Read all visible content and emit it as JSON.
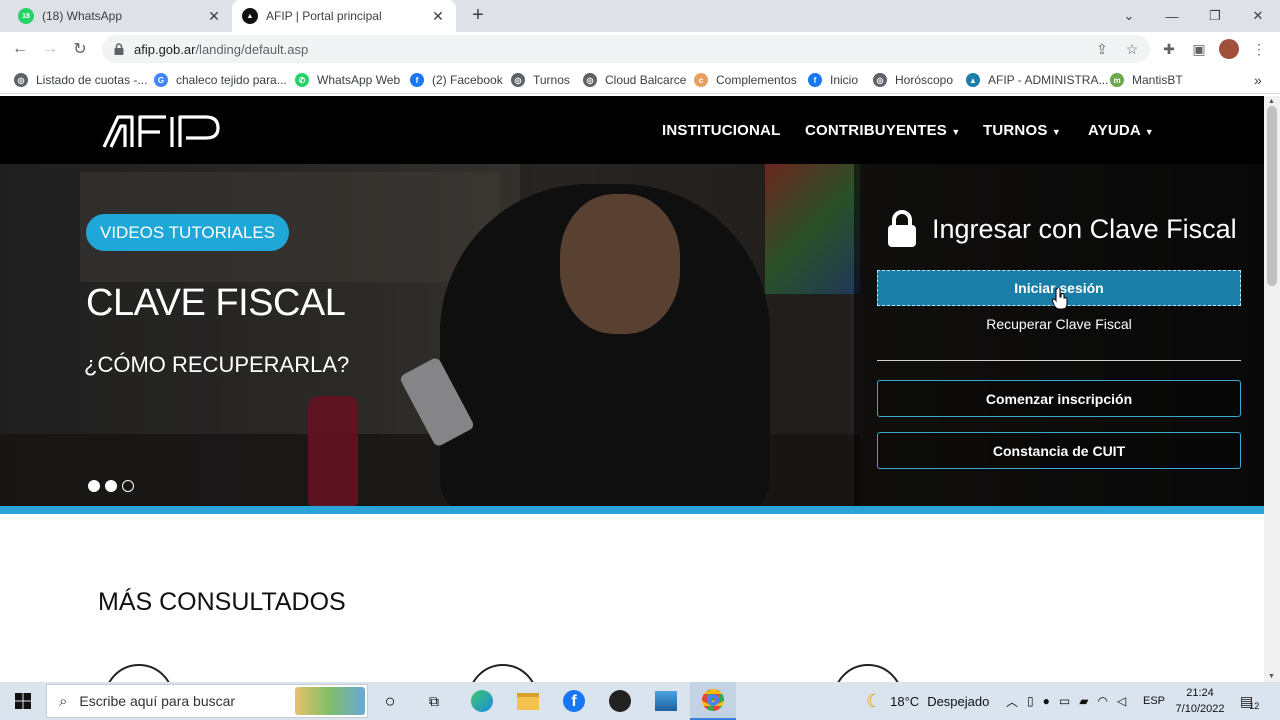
{
  "browser": {
    "tabs": [
      {
        "title": "(18) WhatsApp",
        "badge": "18",
        "active": false
      },
      {
        "title": "AFIP | Portal principal",
        "active": true
      }
    ],
    "url_host": "afip.gob.ar",
    "url_path": "/landing/default.asp",
    "bookmarks": [
      {
        "label": "Listado de cuotas -...",
        "icon": "globe-icon",
        "color": "#5f6368"
      },
      {
        "label": "chaleco tejido para...",
        "icon": "google-icon",
        "color": "#4285f4"
      },
      {
        "label": "WhatsApp Web",
        "icon": "whatsapp-icon",
        "color": "#25d366"
      },
      {
        "label": "(2) Facebook",
        "icon": "facebook-icon",
        "color": "#1877f2"
      },
      {
        "label": "Turnos",
        "icon": "globe-icon",
        "color": "#5f6368"
      },
      {
        "label": "Cloud Balcarce",
        "icon": "globe-icon",
        "color": "#5f6368"
      },
      {
        "label": "Complementos",
        "icon": "complementos-icon",
        "color": "#e8a060"
      },
      {
        "label": "Inicio",
        "icon": "facebook-icon",
        "color": "#1877f2"
      },
      {
        "label": "Horóscopo",
        "icon": "globe-icon",
        "color": "#5f6368"
      },
      {
        "label": "AFIP - ADMINISTRA...",
        "icon": "afip-icon",
        "color": "#1a7ea8"
      },
      {
        "label": "MantisBT",
        "icon": "mantis-icon",
        "color": "#6aa84f"
      }
    ]
  },
  "site": {
    "nav": [
      "INSTITUCIONAL",
      "CONTRIBUYENTES",
      "TURNOS",
      "AYUDA"
    ],
    "nav_dropdown": [
      false,
      true,
      true,
      true
    ],
    "hero": {
      "pill": "VIDEOS TUTORIALES",
      "title": "CLAVE FISCAL",
      "subtitle": "¿CÓMO RECUPERARLA?",
      "slide_count": 3,
      "active_slide": 2
    },
    "login": {
      "title": "Ingresar con Clave Fiscal",
      "login_button": "Iniciar sesión",
      "recover_link": "Recuperar Clave Fiscal",
      "signup_button": "Comenzar inscripción",
      "cuit_button": "Constancia de CUIT"
    },
    "section_title": "MÁS CONSULTADOS"
  },
  "taskbar": {
    "search_placeholder": "Escribe aquí para buscar",
    "weather_temp": "18°C",
    "weather_desc": "Despejado",
    "language": "ESP",
    "time": "21:24",
    "date": "7/10/2022",
    "notification_count": "12"
  },
  "colors": {
    "afip_blue": "#1fa7d8",
    "login_button": "#1a7ea8",
    "header_bg": "#000000"
  }
}
